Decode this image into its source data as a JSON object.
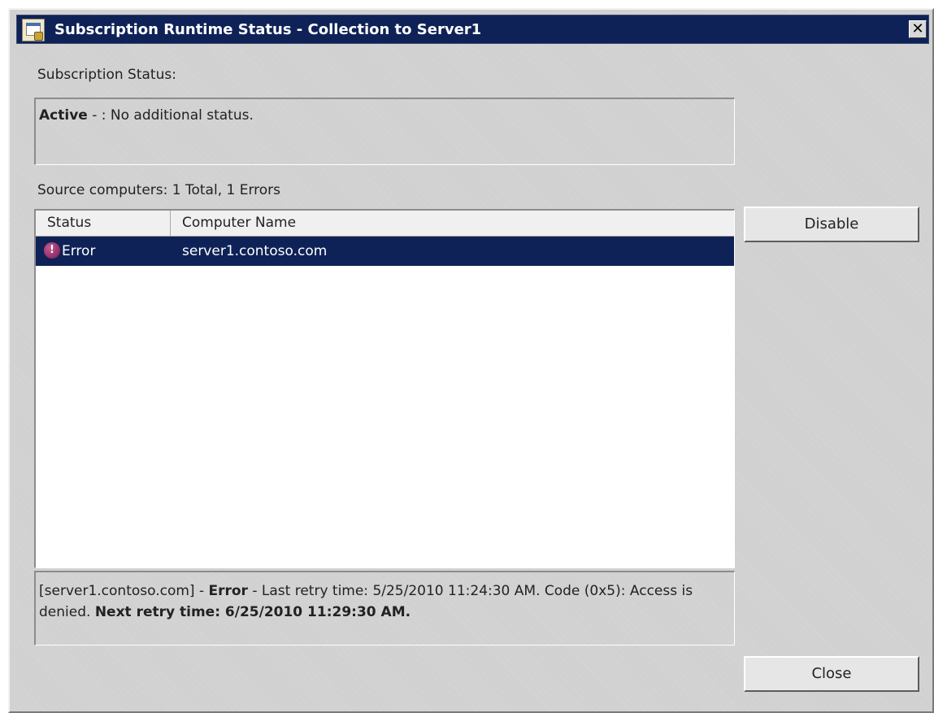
{
  "window": {
    "title": "Subscription Runtime Status - Collection to Server1",
    "close_glyph": "✕",
    "icon": "event-viewer-icon"
  },
  "subscription_status": {
    "label": "Subscription Status:",
    "state": "Active",
    "separator": " - : ",
    "message": "No additional status."
  },
  "source_computers": {
    "label": "Source computers: 1 Total, 1 Errors",
    "columns": [
      "Status",
      "Computer Name"
    ],
    "rows": [
      {
        "status": "Error",
        "computer_name": "server1.contoso.com",
        "icon": "error-icon",
        "selected": true
      }
    ]
  },
  "detail": {
    "host": "[server1.contoso.com] - ",
    "status": "Error",
    "message": " - Last retry time: 5/25/2010 11:24:30 AM. Code (0x5): Access is denied. ",
    "next_retry": "Next retry time: 6/25/2010 11:29:30 AM."
  },
  "buttons": {
    "disable": "Disable",
    "close": "Close"
  },
  "colors": {
    "titlebar": "#0e2257",
    "selection": "#0e2257",
    "dialog_bg": "#d4d4d4"
  }
}
